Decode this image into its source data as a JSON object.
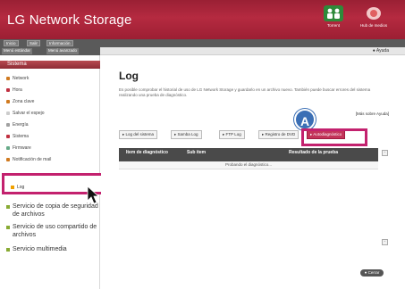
{
  "header": {
    "brand": "LG Network Storage",
    "buttons": [
      {
        "label": "Torrent",
        "icon": "torrent-icon"
      },
      {
        "label": "Hub de medios",
        "icon": "media-hub-icon"
      }
    ]
  },
  "topbar": {
    "buttons": [
      "Inicio",
      "Salir",
      "Información"
    ],
    "help": "Ayuda"
  },
  "sidebar": {
    "menu_tabs": [
      "Menú estándar",
      "Menú avanzado"
    ],
    "category": "Sistema",
    "items": [
      {
        "label": "Network",
        "color": "#d07a20"
      },
      {
        "label": "Hora",
        "color": "#c03040"
      },
      {
        "label": "Zona clave",
        "color": "#d07a20"
      },
      {
        "label": "Salvar el espejo",
        "color": "#ccc"
      },
      {
        "label": "Energía",
        "color": "#a0a0a0"
      },
      {
        "label": "Sistema",
        "color": "#c03040"
      },
      {
        "label": "Firmware",
        "color": "#6a8"
      },
      {
        "label": "Notificación de mail",
        "color": "#d07a20"
      }
    ],
    "selected": {
      "label": "Log"
    },
    "groups": [
      {
        "label": "Servicio de copia de seguridad de archivos"
      },
      {
        "label": "Servicio de uso compartido de archivos"
      },
      {
        "label": "Servicio multimedia"
      }
    ]
  },
  "main": {
    "title": "Log",
    "description": "Es posible comprobar el historial de uso de LG Network Storage y guardarlo en un archivo nuevo. También puede buscar errores del sistema realizando una prueba de diagnóstico.",
    "help_link": "[Más sobre Ayuda]",
    "tabs": [
      "Log del sistema",
      "Samba Log",
      "FTP Log",
      "Registro de DVD",
      "Autodiagnóstico"
    ],
    "active_tab": "Autodiagnóstico",
    "annotation": "A",
    "table": {
      "headers": [
        "Item de diagnóstico",
        "Sub item",
        "Resultado de la prueba"
      ],
      "status": "Probando el diagnóstico..."
    },
    "close_button": "Cerrar"
  }
}
